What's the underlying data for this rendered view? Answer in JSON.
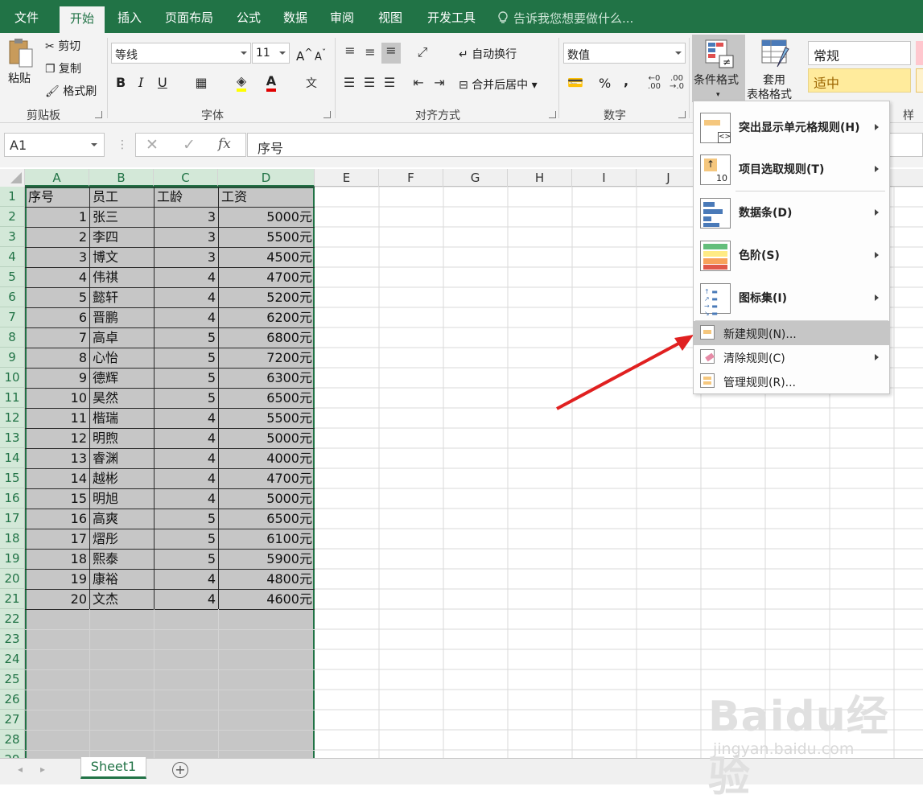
{
  "tabs": [
    "文件",
    "开始",
    "插入",
    "页面布局",
    "公式",
    "数据",
    "审阅",
    "视图",
    "开发工具"
  ],
  "tell_me": "告诉我您想要做什么...",
  "clipboard": {
    "paste": "粘贴",
    "cut": "剪切",
    "copy": "复制",
    "format_painter": "格式刷",
    "label": "剪贴板"
  },
  "font": {
    "name": "等线",
    "size": "11",
    "grow": "A",
    "shrink": "A",
    "bold": "B",
    "italic": "I",
    "underline": "U",
    "label": "字体"
  },
  "alignment": {
    "wrap": "自动换行",
    "merge": "合并后居中",
    "label": "对齐方式"
  },
  "number": {
    "format": "数值",
    "percent": "%",
    "comma": ",",
    "label": "数字"
  },
  "styles": {
    "conditional": "条件格式",
    "table_format_1": "套用",
    "table_format_2": "表格格式",
    "style_normal": "常规",
    "style_neutral": "适中",
    "label_partial": "样式"
  },
  "formula_bar": {
    "name_box": "A1",
    "content": "序号",
    "fx": "fx"
  },
  "columns": [
    "A",
    "B",
    "C",
    "D",
    "E",
    "F",
    "G",
    "H",
    "I",
    "J",
    "N"
  ],
  "rows": [
    "1",
    "2",
    "3",
    "4",
    "5",
    "6",
    "7",
    "8",
    "9",
    "10",
    "11",
    "12",
    "13",
    "14",
    "15",
    "16",
    "17",
    "18",
    "19",
    "20",
    "21",
    "22",
    "23",
    "24",
    "25",
    "26",
    "27",
    "28",
    "29"
  ],
  "headers": [
    "序号",
    "员工",
    "工龄",
    "工资"
  ],
  "data_rows": [
    [
      "1",
      "张三",
      "3",
      "5000元"
    ],
    [
      "2",
      "李四",
      "3",
      "5500元"
    ],
    [
      "3",
      "博文",
      "3",
      "4500元"
    ],
    [
      "4",
      "伟祺",
      "4",
      "4700元"
    ],
    [
      "5",
      "懿轩",
      "4",
      "5200元"
    ],
    [
      "6",
      "晋鹏",
      "4",
      "6200元"
    ],
    [
      "7",
      "高卓",
      "5",
      "6800元"
    ],
    [
      "8",
      "心怡",
      "5",
      "7200元"
    ],
    [
      "9",
      "德辉",
      "5",
      "6300元"
    ],
    [
      "10",
      "昊然",
      "5",
      "6500元"
    ],
    [
      "11",
      "楷瑞",
      "4",
      "5500元"
    ],
    [
      "12",
      "明煦",
      "4",
      "5000元"
    ],
    [
      "13",
      "睿渊",
      "4",
      "4000元"
    ],
    [
      "14",
      "越彬",
      "4",
      "4700元"
    ],
    [
      "15",
      "明旭",
      "4",
      "5000元"
    ],
    [
      "16",
      "高爽",
      "5",
      "6500元"
    ],
    [
      "17",
      "熠彤",
      "5",
      "6100元"
    ],
    [
      "18",
      "熙泰",
      "5",
      "5900元"
    ],
    [
      "19",
      "康裕",
      "4",
      "4800元"
    ],
    [
      "20",
      "文杰",
      "4",
      "4600元"
    ]
  ],
  "menu": [
    {
      "label": "突出显示单元格规则(H)",
      "submenu": true
    },
    {
      "label": "项目选取规则(T)",
      "submenu": true
    },
    {
      "label": "数据条(D)",
      "submenu": true
    },
    {
      "label": "色阶(S)",
      "submenu": true
    },
    {
      "label": "图标集(I)",
      "submenu": true
    },
    {
      "label": "新建规则(N)...",
      "submenu": false
    },
    {
      "label": "清除规则(C)",
      "submenu": true
    },
    {
      "label": "管理规则(R)...",
      "submenu": false
    }
  ],
  "sheet_tab": "Sheet1",
  "add_sheet": "+",
  "watermark": {
    "logo": "Baidu经验",
    "url": "jingyan.baidu.com"
  },
  "colors": {
    "excel_green": "#217346",
    "selection_gray": "#c6c6c6",
    "arrow_red": "#e02020"
  }
}
